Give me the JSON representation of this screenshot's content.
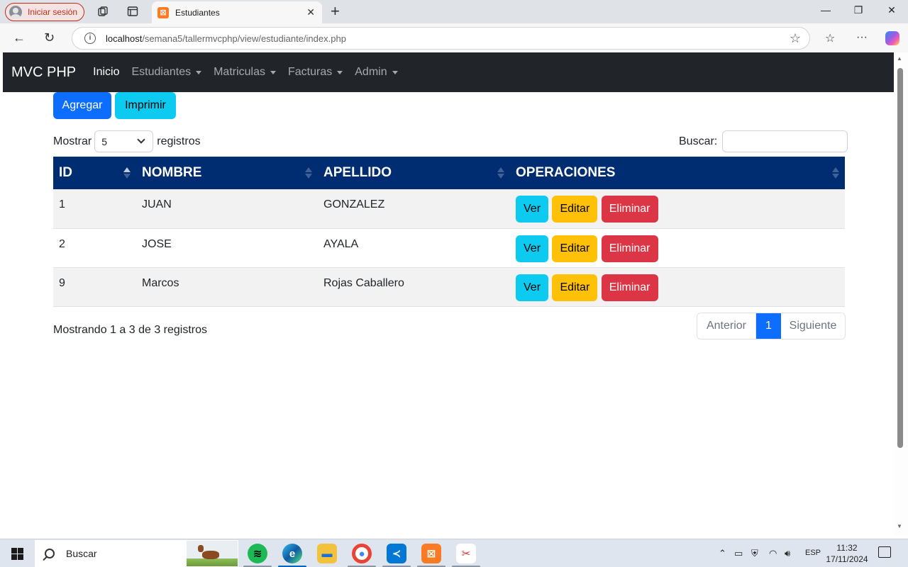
{
  "browser": {
    "profile_label": "Iniciar sesión",
    "tab_title": "Estudiantes",
    "url_host": "localhost",
    "url_path": "/semana5/tallermvcphp/view/estudiante/index.php"
  },
  "navbar": {
    "brand": "MVC PHP",
    "links": [
      {
        "label": "Inicio",
        "active": true
      },
      {
        "label": "Estudiantes",
        "dropdown": true
      },
      {
        "label": "Matriculas",
        "dropdown": true
      },
      {
        "label": "Facturas",
        "dropdown": true
      },
      {
        "label": "Admin",
        "dropdown": true
      }
    ]
  },
  "actions": {
    "add_label": "Agregar",
    "print_label": "Imprimir"
  },
  "length": {
    "prefix": "Mostrar",
    "value": "5",
    "suffix": "registros"
  },
  "search": {
    "label": "Buscar:",
    "value": ""
  },
  "table": {
    "columns": [
      "ID",
      "NOMBRE",
      "APELLIDO",
      "OPERACIONES"
    ],
    "rows": [
      {
        "id": "1",
        "nombre": "JUAN",
        "apellido": "GONZALEZ"
      },
      {
        "id": "2",
        "nombre": "JOSE",
        "apellido": "AYALA"
      },
      {
        "id": "9",
        "nombre": "Marcos",
        "apellido": "Rojas Caballero"
      }
    ],
    "row_actions": {
      "view": "Ver",
      "edit": "Editar",
      "delete": "Eliminar"
    }
  },
  "footer": {
    "info": "Mostrando 1 a 3 de 3 registros",
    "prev": "Anterior",
    "current_page": "1",
    "next": "Siguiente"
  },
  "taskbar": {
    "search_label": "Buscar",
    "language": "ESP",
    "time": "11:32",
    "date": "17/11/2024"
  },
  "colors": {
    "navbar_bg": "#212529",
    "table_header_bg": "#002c72",
    "primary": "#0d6efd",
    "info": "#0dcaf0",
    "warning": "#ffc107",
    "danger": "#dc3545"
  }
}
